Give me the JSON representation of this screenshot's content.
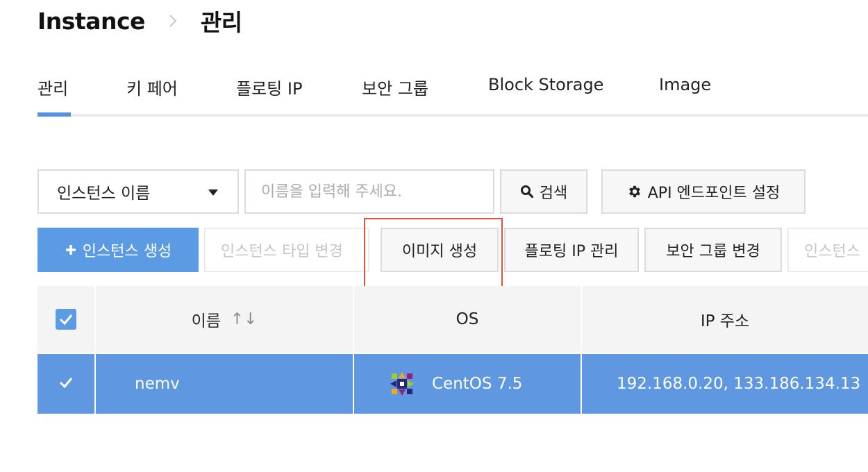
{
  "breadcrumb": {
    "root": "Instance",
    "current": "관리"
  },
  "tabs": [
    {
      "label": "관리",
      "active": true
    },
    {
      "label": "키 페어"
    },
    {
      "label": "플로팅 IP"
    },
    {
      "label": "보안 그룹"
    },
    {
      "label": "Block Storage"
    },
    {
      "label": "Image"
    }
  ],
  "search": {
    "field_selected": "인스턴스 이름",
    "placeholder": "이름을 입력해 주세요.",
    "search_button": "검색",
    "api_button": "API 엔드포인트 설정"
  },
  "actions": {
    "create": "인스턴스 생성",
    "change_type": "인스턴스 타입 변경",
    "create_image": "이미지 생성",
    "floating_ip": "플로팅 IP 관리",
    "security_group": "보안 그룹 변경",
    "more": "인스턴스"
  },
  "table": {
    "columns": [
      "이름",
      "OS",
      "IP 주소"
    ],
    "sort_icon": "↑↓",
    "rows": [
      {
        "name": "nemv",
        "os": "CentOS 7.5",
        "ip": "192.168.0.20, 133.186.134.13",
        "selected": true
      }
    ]
  },
  "colors": {
    "accent": "#5b9be3",
    "row_selected": "#5f98e1",
    "highlight_box": "#e0533b"
  }
}
